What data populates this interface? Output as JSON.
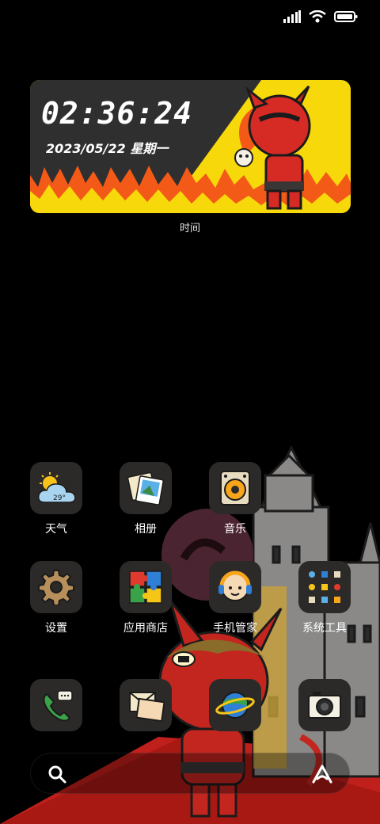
{
  "status_bar": {
    "signal_icon": "signal-icon",
    "wifi_icon": "wifi-icon",
    "battery_icon": "battery-icon"
  },
  "clock_widget": {
    "time": "02:36:24",
    "date": "2023/05/22 星期一",
    "label": "时间"
  },
  "apps": [
    {
      "id": "weather",
      "label": "天气",
      "icon": "weather-icon",
      "temp": "29°"
    },
    {
      "id": "gallery",
      "label": "相册",
      "icon": "gallery-icon"
    },
    {
      "id": "music",
      "label": "音乐",
      "icon": "music-icon"
    },
    {
      "id": "settings",
      "label": "设置",
      "icon": "gear-icon"
    },
    {
      "id": "appstore",
      "label": "应用商店",
      "icon": "puzzle-icon"
    },
    {
      "id": "security",
      "label": "手机管家",
      "icon": "assistant-icon"
    },
    {
      "id": "tools",
      "label": "系统工具",
      "icon": "folder-icon"
    }
  ],
  "dock": [
    {
      "id": "phone",
      "icon": "phone-icon"
    },
    {
      "id": "messages",
      "icon": "envelope-icon"
    },
    {
      "id": "browser",
      "icon": "planet-icon"
    },
    {
      "id": "camera",
      "icon": "camera-icon"
    }
  ],
  "search_bar": {
    "search_icon": "search-icon",
    "assistant_icon": "ai-assistant-icon"
  },
  "colors": {
    "widget_yellow": "#f7d80a",
    "widget_dark": "#2f2f2f",
    "flame_orange": "#f35a18",
    "devil_red": "#d62a25",
    "tile_bg": "#2c2a29",
    "carpet_red": "#c0201b"
  }
}
